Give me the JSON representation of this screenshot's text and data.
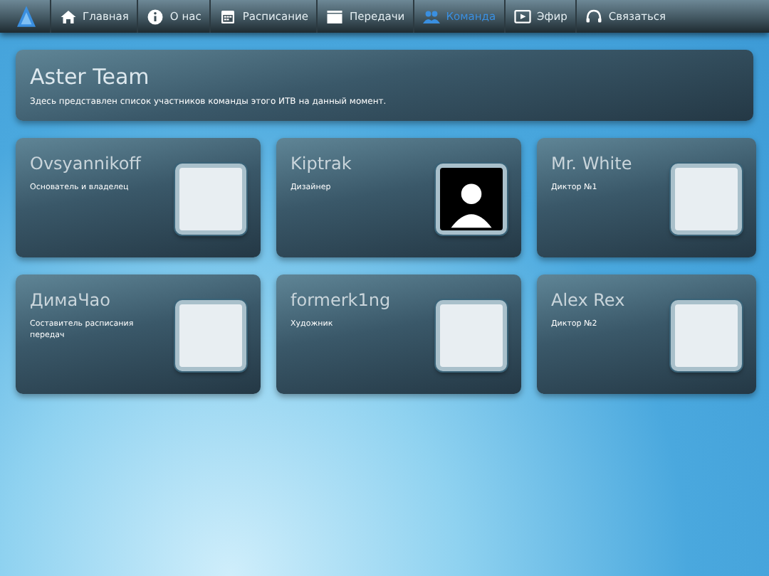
{
  "nav": [
    {
      "kind": "home",
      "label": "Главная",
      "selected": false
    },
    {
      "kind": "info",
      "label": "О нас",
      "selected": false
    },
    {
      "kind": "calendar",
      "label": "Расписание",
      "selected": false
    },
    {
      "kind": "clapper",
      "label": "Передачи",
      "selected": false
    },
    {
      "kind": "people",
      "label": "Команда",
      "selected": true
    },
    {
      "kind": "play",
      "label": "Эфир",
      "selected": false
    },
    {
      "kind": "headset",
      "label": "Связаться",
      "selected": false
    }
  ],
  "header": {
    "title": "Aster Team",
    "description": "Здесь представлен список участников команды этого ИТВ на данный момент."
  },
  "members": [
    {
      "name": "Ovsyannikoff",
      "role": "Основатель и владелец",
      "kind": "photo"
    },
    {
      "name": "Kiptrak",
      "role": "Дизайнер",
      "kind": "blank"
    },
    {
      "name": "Mr. White",
      "role": "Диктор №1",
      "kind": "photo"
    },
    {
      "name": "ДимаЧао",
      "role": "Составитель расписания передач",
      "kind": "photo"
    },
    {
      "name": "formerk1ng",
      "role": "Художник",
      "kind": "photo"
    },
    {
      "name": "Alex Rex",
      "role": "Диктор №2",
      "kind": "photo"
    }
  ]
}
